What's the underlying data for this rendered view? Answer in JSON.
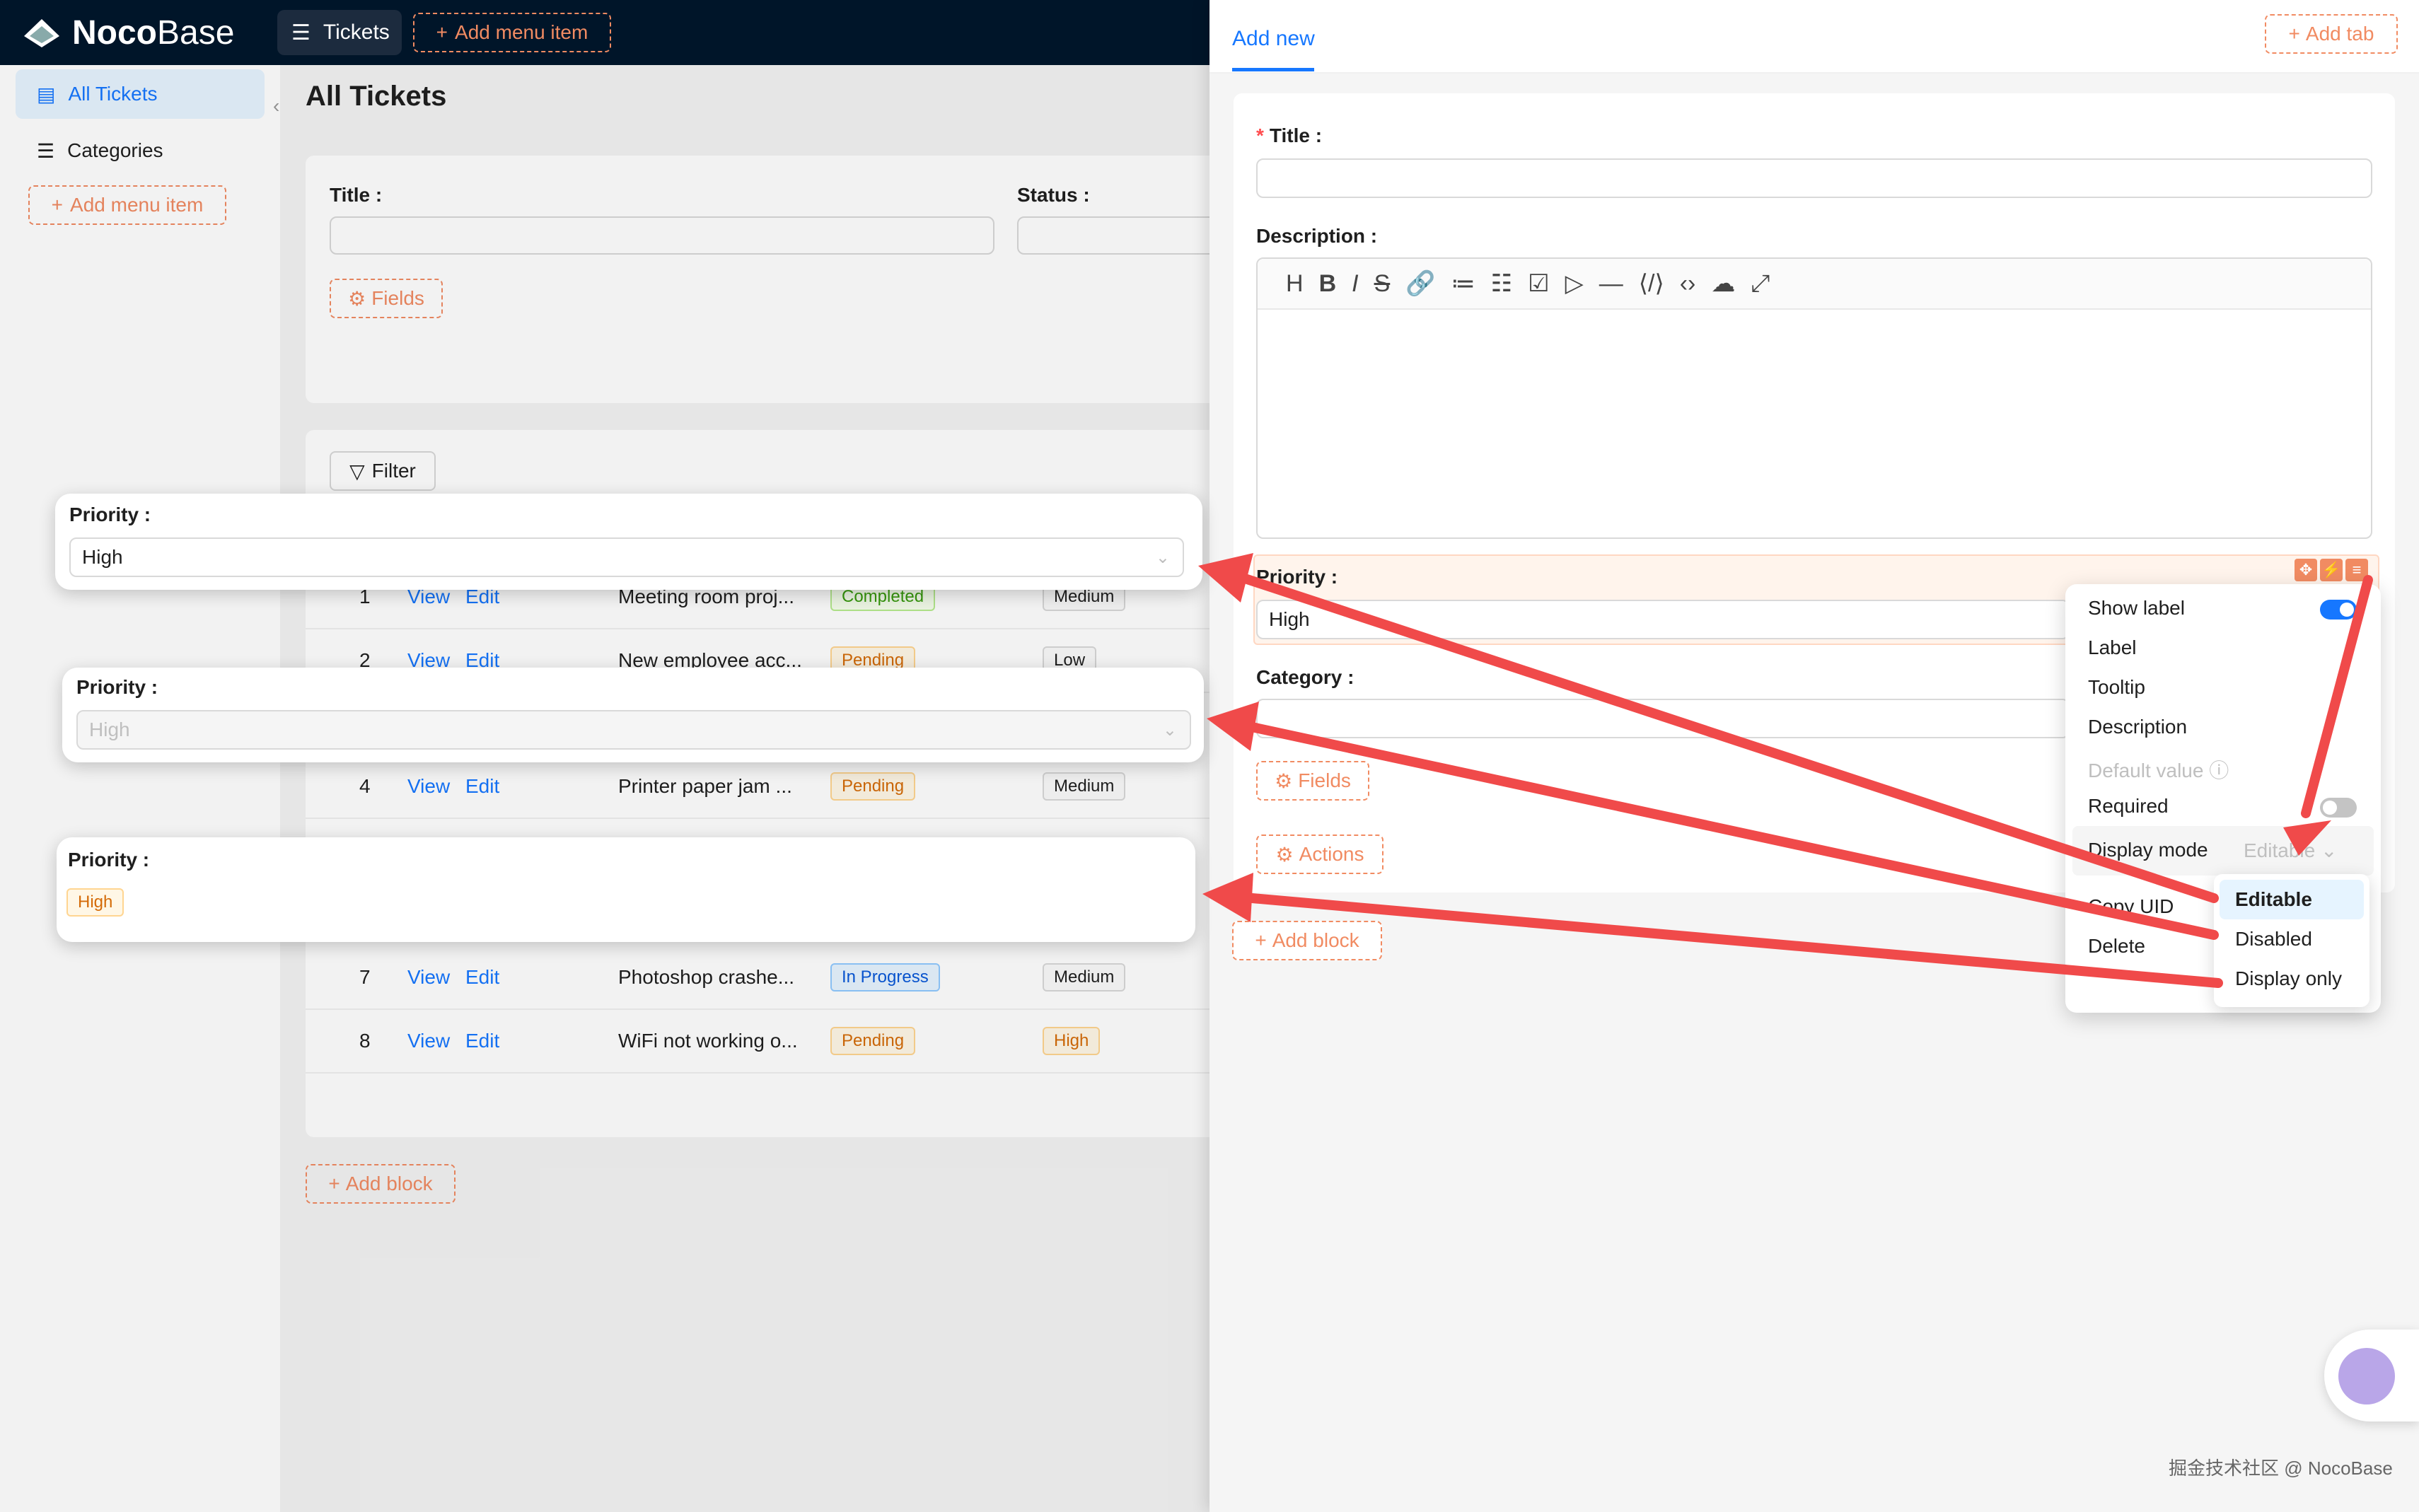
{
  "header": {
    "logo_bold": "Noco",
    "logo_light": "Base",
    "tickets_label": "Tickets",
    "add_menu_label": "Add menu item"
  },
  "sidebar": {
    "items": [
      {
        "label": "All Tickets"
      },
      {
        "label": "Categories"
      }
    ],
    "add_menu_label": "Add menu item"
  },
  "page": {
    "title": "All Tickets",
    "filter_form": {
      "title_label": "Title :",
      "status_label": "Status :",
      "fields_label": "Fields"
    },
    "table": {
      "filter_label": "Filter",
      "view_label": "View",
      "edit_label": "Edit",
      "rows": [
        {
          "no": "1",
          "title": "Meeting room proj...",
          "status": "Completed",
          "priority": "Medium"
        },
        {
          "no": "2",
          "title": "New employee acc...",
          "status": "Pending",
          "priority": "Low"
        },
        {
          "no": "4",
          "title": "Printer paper jam ...",
          "status": "Pending",
          "priority": "Medium"
        },
        {
          "no": "7",
          "title": "Photoshop crashe...",
          "status": "In Progress",
          "priority": "Medium"
        },
        {
          "no": "8",
          "title": "WiFi not working o...",
          "status": "Pending",
          "priority": "High"
        }
      ]
    },
    "add_block_label": "Add block"
  },
  "drawer": {
    "tab_label": "Add new",
    "add_tab_label": "Add tab",
    "title_label": "Title :",
    "required_mark": "*",
    "description_label": "Description :",
    "priority_label": "Priority :",
    "priority_value": "High",
    "category_label": "Category :",
    "fields_label": "Fields",
    "actions_label": "Actions",
    "add_block_label": "Add block"
  },
  "popover": {
    "show_label": "Show label",
    "label": "Label",
    "tooltip": "Tooltip",
    "description": "Description",
    "default_value": "Default value",
    "required": "Required",
    "display_mode": "Display mode",
    "display_mode_value": "Editable",
    "copy_uid": "Copy UID",
    "delete": "Delete",
    "options": [
      "Editable",
      "Disabled",
      "Display only"
    ]
  },
  "examples": {
    "editable": {
      "label": "Priority :",
      "value": "High"
    },
    "disabled": {
      "label": "Priority :",
      "value": "High"
    },
    "display_only": {
      "label": "Priority :",
      "value": "High"
    }
  },
  "watermark": "掘金技术社区 @ NocoBase",
  "colors": {
    "primary": "#1677ff",
    "accent_orange": "#f18b62",
    "arrow": "#f04a4a",
    "header_bg": "#001529"
  }
}
